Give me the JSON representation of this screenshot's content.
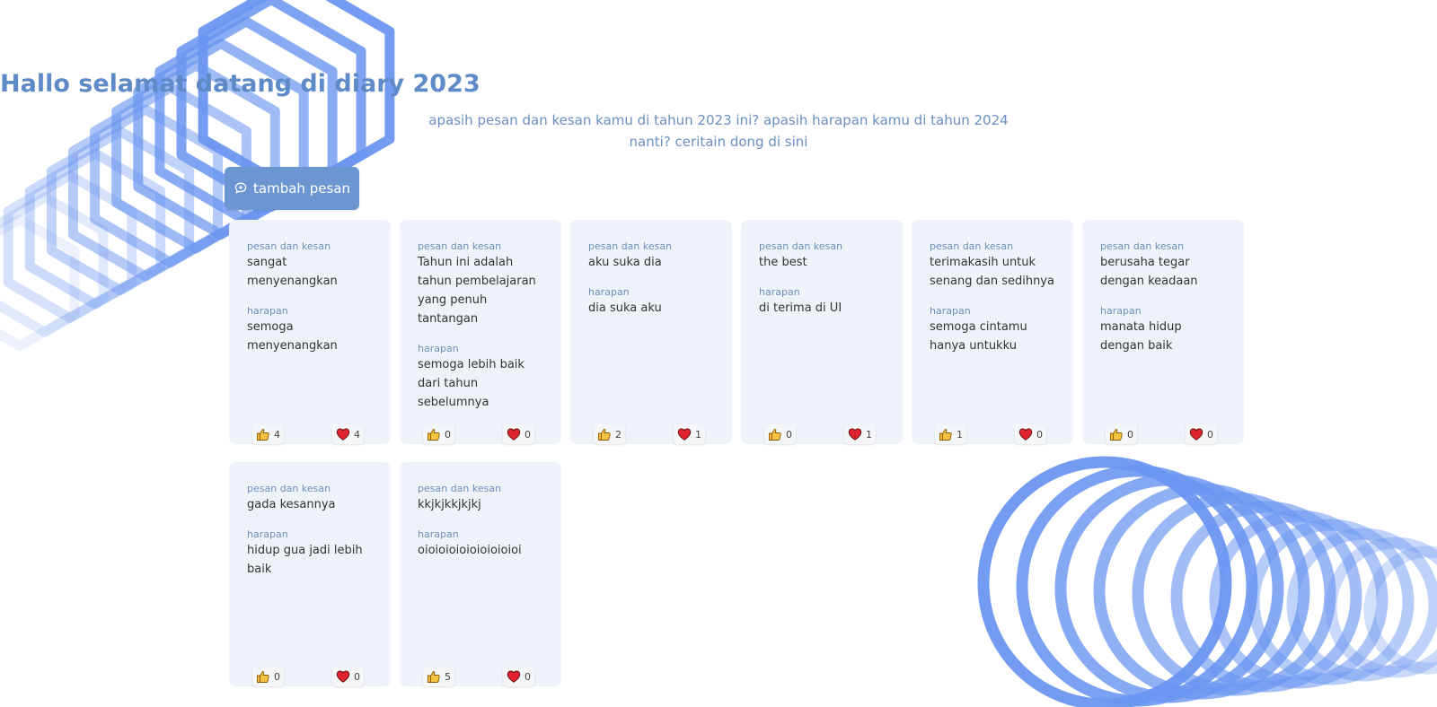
{
  "header": {
    "title": "Hallo selamat datang di diary 2023",
    "subtitle": "apasih pesan dan kesan kamu di tahun 2023 ini? apasih harapan kamu di tahun 2024 nanti? ceritain dong di sini"
  },
  "add_button": {
    "label": "tambah pesan",
    "icon": "message-plus-icon"
  },
  "labels": {
    "pesan": "pesan dan kesan",
    "harapan": "harapan"
  },
  "colors": {
    "accent": "#5e8ac7",
    "button": "#6b96d1",
    "card": "#eef2f9",
    "decor": "#6b96f0"
  },
  "cards": [
    {
      "pesan_label": "pesan dan kesan",
      "pesan": "sangat menyenangkan",
      "harapan_label": "harapan",
      "harapan": "semoga menyenangkan",
      "likes": "4",
      "loves": "4"
    },
    {
      "pesan_label": "pesan dan kesan",
      "pesan": "Tahun ini adalah tahun pembelajaran yang penuh tantangan",
      "harapan_label": "harapan",
      "harapan": "semoga lebih baik dari tahun sebelumnya",
      "likes": "0",
      "loves": "0"
    },
    {
      "pesan_label": "pesan dan kesan",
      "pesan": "aku suka dia",
      "harapan_label": "harapan",
      "harapan": "dia suka aku",
      "likes": "2",
      "loves": "1"
    },
    {
      "pesan_label": "pesan dan kesan",
      "pesan": "the best",
      "harapan_label": "harapan",
      "harapan": "di terima di UI",
      "likes": "0",
      "loves": "1"
    },
    {
      "pesan_label": "pesan dan kesan",
      "pesan": "terimakasih untuk senang dan sedihnya",
      "harapan_label": "harapan",
      "harapan": "semoga cintamu hanya untukku",
      "likes": "1",
      "loves": "0"
    },
    {
      "pesan_label": "pesan dan kesan",
      "pesan": "berusaha tegar dengan keadaan",
      "harapan_label": "harapan",
      "harapan": "manata hidup dengan baik",
      "likes": "0",
      "loves": "0"
    },
    {
      "pesan_label": "pesan dan kesan",
      "pesan": "gada kesannya",
      "harapan_label": "harapan",
      "harapan": "hidup gua jadi lebih baik",
      "likes": "0",
      "loves": "0"
    },
    {
      "pesan_label": "pesan dan kesan",
      "pesan": "kkjkjkkjkjkj",
      "harapan_label": "harapan",
      "harapan": "oioioioioioioioioioi",
      "likes": "5",
      "loves": "0"
    }
  ]
}
